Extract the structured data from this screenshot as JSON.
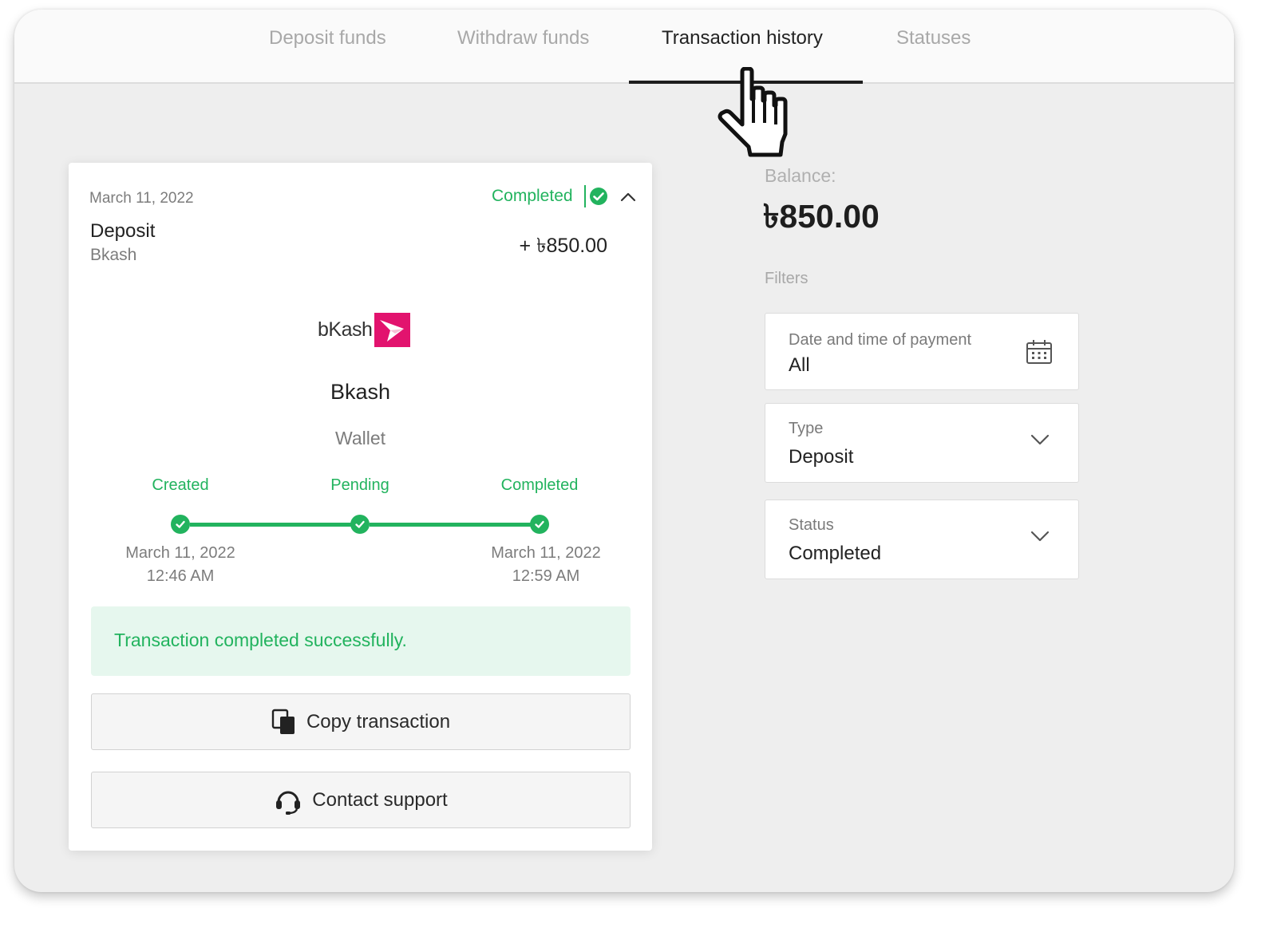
{
  "tabs": [
    {
      "label": "Deposit funds"
    },
    {
      "label": "Withdraw funds"
    },
    {
      "label": "Transaction history"
    },
    {
      "label": "Statuses"
    }
  ],
  "active_tab": "Transaction history",
  "transaction": {
    "date": "March 11, 2022",
    "status": "Completed",
    "type": "Deposit",
    "method": "Bkash",
    "amount": "+ ৳850.00",
    "logo_text": "bKash",
    "provider_name": "Bkash",
    "provider_kind": "Wallet",
    "steps": [
      {
        "label": "Created",
        "date": "March 11, 2022",
        "time": "12:46 AM"
      },
      {
        "label": "Pending",
        "date": "",
        "time": ""
      },
      {
        "label": "Completed",
        "date": "March 11, 2022",
        "time": "12:59 AM"
      }
    ],
    "message": "Transaction completed successfully.",
    "copy_button": "Copy transaction",
    "support_button": "Contact support"
  },
  "balance": {
    "label": "Balance:",
    "value": "৳850.00"
  },
  "filters": {
    "heading": "Filters",
    "date": {
      "label": "Date and time of payment",
      "value": "All"
    },
    "type": {
      "label": "Type",
      "value": "Deposit"
    },
    "status": {
      "label": "Status",
      "value": "Completed"
    }
  },
  "colors": {
    "accent_green": "#22b35e",
    "success_bg": "#e6f7ee",
    "bkash_pink": "#e2136e"
  },
  "icons": [
    "check-circle-icon",
    "chevron-up-icon",
    "bkash-logo",
    "copy-icon",
    "headset-icon",
    "calendar-icon",
    "chevron-down-icon",
    "hand-cursor-icon"
  ]
}
